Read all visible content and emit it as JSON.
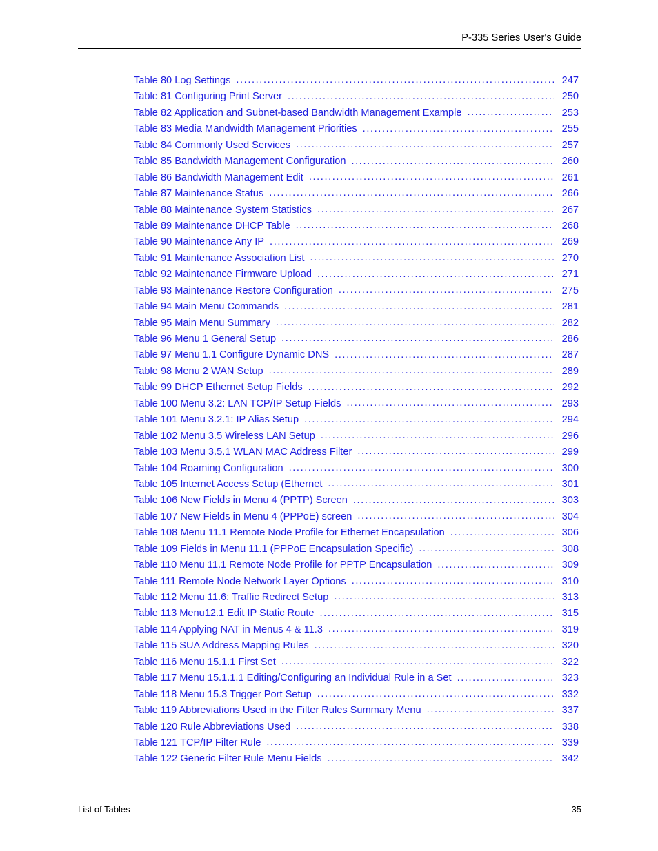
{
  "header": {
    "title": "P-335 Series User's Guide"
  },
  "footer": {
    "section": "List of Tables",
    "page_number": "35"
  },
  "colors": {
    "entry_text": "#2020e0",
    "rule": "#000000",
    "header_text": "#000000",
    "background": "#ffffff"
  },
  "toc": {
    "entries": [
      {
        "label": "Table 80 Log Settings",
        "page": "247"
      },
      {
        "label": "Table 81 Configuring Print Server",
        "page": "250"
      },
      {
        "label": "Table 82 Application and Subnet-based Bandwidth Management Example",
        "page": "253"
      },
      {
        "label": "Table 83 Media Mandwidth Management Priorities",
        "page": "255"
      },
      {
        "label": "Table 84 Commonly Used Services",
        "page": "257"
      },
      {
        "label": "Table 85 Bandwidth Management Configuration",
        "page": "260"
      },
      {
        "label": "Table 86 Bandwidth Management Edit",
        "page": "261"
      },
      {
        "label": "Table 87 Maintenance Status",
        "page": "266"
      },
      {
        "label": "Table 88 Maintenance System Statistics",
        "page": "267"
      },
      {
        "label": "Table 89 Maintenance DHCP Table",
        "page": "268"
      },
      {
        "label": "Table 90 Maintenance Any IP",
        "page": "269"
      },
      {
        "label": "Table 91 Maintenance Association List",
        "page": "270"
      },
      {
        "label": "Table 92 Maintenance Firmware Upload",
        "page": "271"
      },
      {
        "label": "Table 93 Maintenance Restore Configuration",
        "page": "275"
      },
      {
        "label": "Table 94 Main Menu Commands",
        "page": "281"
      },
      {
        "label": "Table 95 Main Menu Summary",
        "page": "282"
      },
      {
        "label": "Table 96 Menu 1 General Setup",
        "page": "286"
      },
      {
        "label": "Table 97 Menu 1.1 Configure Dynamic DNS",
        "page": "287"
      },
      {
        "label": "Table 98 Menu 2 WAN Setup",
        "page": "289"
      },
      {
        "label": "Table 99 DHCP Ethernet Setup Fields",
        "page": "292"
      },
      {
        "label": "Table 100 Menu 3.2: LAN TCP/IP Setup Fields",
        "page": "293"
      },
      {
        "label": "Table 101 Menu 3.2.1: IP Alias Setup",
        "page": "294"
      },
      {
        "label": "Table 102 Menu 3.5 Wireless LAN Setup",
        "page": "296"
      },
      {
        "label": "Table 103 Menu 3.5.1 WLAN MAC Address Filter",
        "page": "299"
      },
      {
        "label": "Table 104 Roaming Configuration",
        "page": "300"
      },
      {
        "label": "Table 105 Internet Access Setup  (Ethernet",
        "page": "301"
      },
      {
        "label": "Table 106 New Fields in Menu 4 (PPTP) Screen",
        "page": "303"
      },
      {
        "label": "Table 107 New Fields in Menu 4 (PPPoE) screen",
        "page": "304"
      },
      {
        "label": "Table 108 Menu 11.1 Remote Node Profile for Ethernet Encapsulation",
        "page": "306"
      },
      {
        "label": "Table 109 Fields in Menu 11.1 (PPPoE Encapsulation Specific)",
        "page": "308"
      },
      {
        "label": "Table 110 Menu 11.1 Remote Node Profile for PPTP Encapsulation",
        "page": "309"
      },
      {
        "label": "Table 111 Remote Node Network Layer Options",
        "page": "310"
      },
      {
        "label": "Table 112 Menu 11.6: Traffic Redirect Setup",
        "page": "313"
      },
      {
        "label": "Table 113 Menu12.1 Edit IP Static Route",
        "page": "315"
      },
      {
        "label": "Table 114 Applying NAT in Menus 4 & 11.3",
        "page": "319"
      },
      {
        "label": "Table 115 SUA Address Mapping Rules",
        "page": "320"
      },
      {
        "label": "Table 116 Menu 15.1.1 First Set",
        "page": "322"
      },
      {
        "label": "Table 117 Menu 15.1.1.1 Editing/Configuring an Individual Rule in a Set",
        "page": "323"
      },
      {
        "label": "Table 118 Menu 15.3 Trigger Port Setup",
        "page": "332"
      },
      {
        "label": "Table 119 Abbreviations Used in the Filter Rules Summary Menu",
        "page": "337"
      },
      {
        "label": "Table 120 Rule Abbreviations Used",
        "page": "338"
      },
      {
        "label": "Table 121 TCP/IP Filter Rule",
        "page": "339"
      },
      {
        "label": "Table 122 Generic Filter Rule Menu Fields",
        "page": "342"
      }
    ]
  }
}
